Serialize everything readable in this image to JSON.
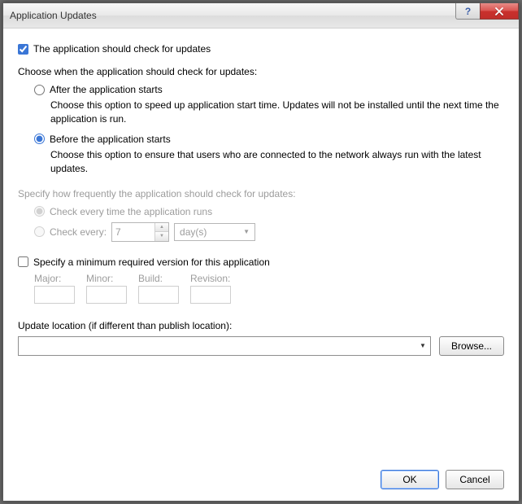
{
  "window": {
    "title": "Application Updates"
  },
  "check_updates": {
    "label": "The application should check for updates",
    "checked": true
  },
  "when_heading": "Choose when the application should check for updates:",
  "option_after": {
    "label": "After the application starts",
    "desc": "Choose this option to speed up application start time. Updates will not be installed until the next time the application is run.",
    "selected": false
  },
  "option_before": {
    "label": "Before the application starts",
    "desc": "Choose this option to ensure that users who are connected to the network always run with the latest updates.",
    "selected": true
  },
  "frequency": {
    "heading": "Specify how frequently the application should check for updates:",
    "every_run_label": "Check every time the application runs",
    "every_run_selected": true,
    "every_label": "Check every:",
    "every_selected": false,
    "interval_value": "7",
    "interval_unit": "day(s)"
  },
  "minver": {
    "label": "Specify a minimum required version for this application",
    "checked": false,
    "major_label": "Major:",
    "minor_label": "Minor:",
    "build_label": "Build:",
    "revision_label": "Revision:",
    "major": "",
    "minor": "",
    "build": "",
    "revision": ""
  },
  "location": {
    "label": "Update location (if different than publish location):",
    "value": "",
    "browse_label": "Browse..."
  },
  "buttons": {
    "ok": "OK",
    "cancel": "Cancel"
  }
}
